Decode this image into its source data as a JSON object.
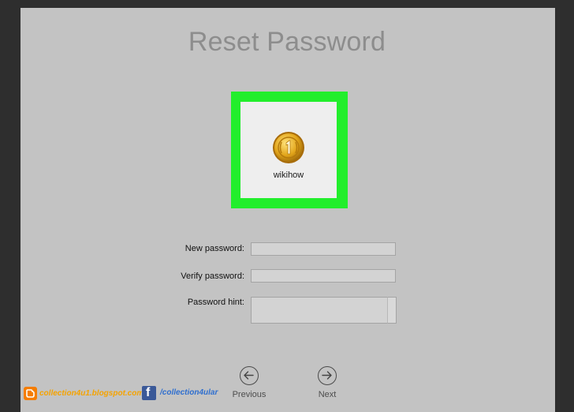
{
  "dialog": {
    "title": "Reset Password",
    "user": {
      "name": "wikihow",
      "avatar_icon": "gold-coin-icon"
    }
  },
  "form": {
    "new_password_label": "New password:",
    "new_password_value": "",
    "verify_password_label": "Verify password:",
    "verify_password_value": "",
    "hint_label": "Password hint:",
    "hint_value": ""
  },
  "navigation": {
    "previous_label": "Previous",
    "next_label": "Next"
  },
  "watermark": {
    "blog_text": "collection4u1.blogspot.com",
    "facebook_text": "/collection4ular",
    "blog_icon": "blogger-icon",
    "facebook_icon": "facebook-icon"
  },
  "colors": {
    "highlight": "#22ee2c",
    "background": "#c3c3c3",
    "window_frame": "#2e2e2e"
  }
}
